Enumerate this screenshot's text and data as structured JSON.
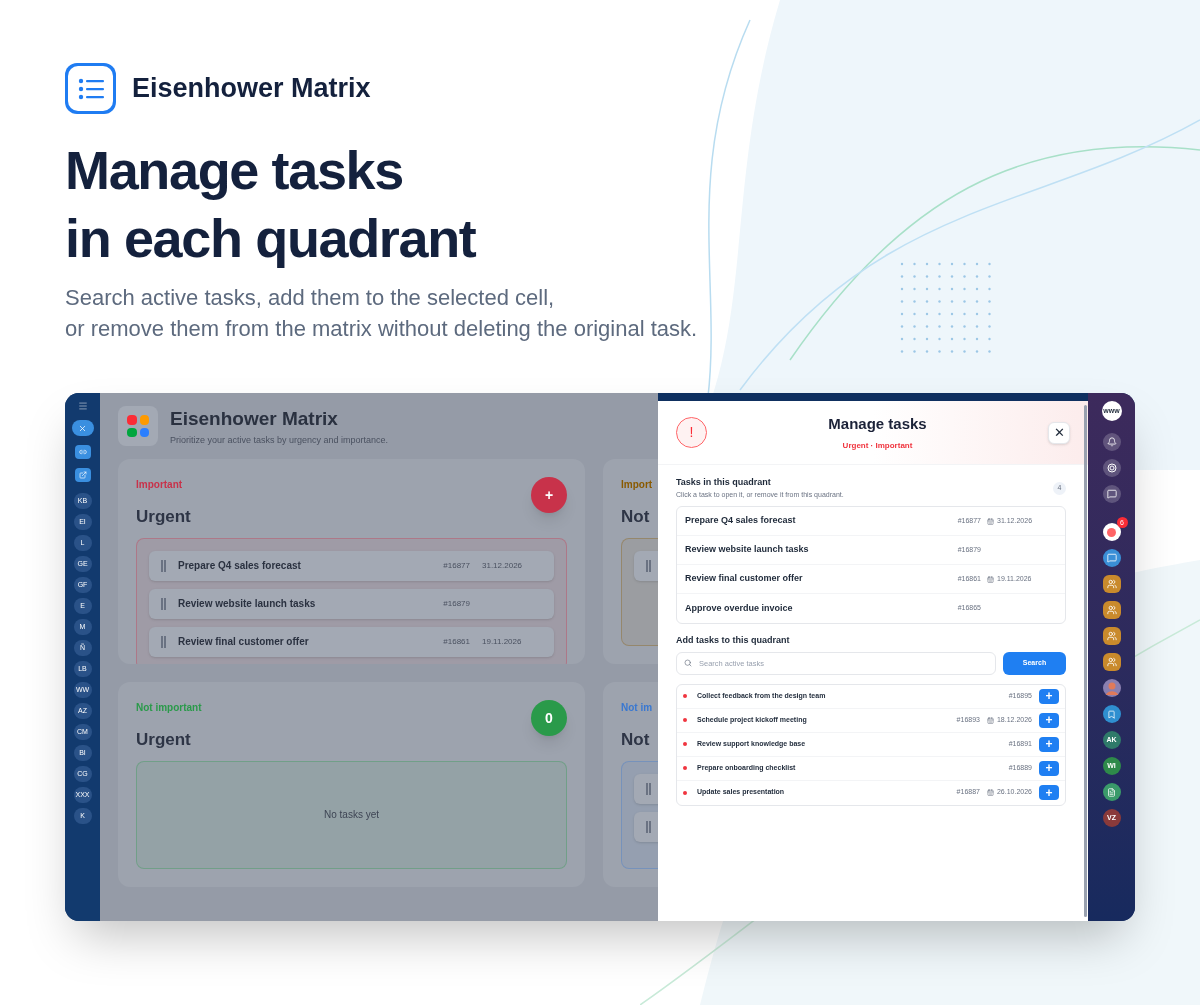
{
  "brand": {
    "title": "Eisenhower Matrix"
  },
  "hero": {
    "heading_lines": [
      "Manage tasks",
      "in each quadrant"
    ],
    "subtitle_lines": [
      "Search active tasks, add them to the selected cell,",
      "or remove them from the matrix without deleting the original task."
    ]
  },
  "sidebar": {
    "items": [
      {
        "initials": "KB"
      },
      {
        "initials": "EI"
      },
      {
        "initials": "L"
      },
      {
        "initials": "GE"
      },
      {
        "initials": "GF"
      },
      {
        "initials": "E"
      },
      {
        "initials": "M"
      },
      {
        "initials": "Ñ"
      },
      {
        "initials": "LB"
      },
      {
        "initials": "WW"
      },
      {
        "initials": "AZ"
      },
      {
        "initials": "CM"
      },
      {
        "initials": "BI"
      },
      {
        "initials": "CG"
      },
      {
        "initials": "XXX"
      },
      {
        "initials": "K"
      }
    ]
  },
  "page": {
    "title": "Eisenhower Matrix",
    "subtitle": "Prioritize your active tasks by urgency and importance."
  },
  "quadrants": [
    {
      "tag": "Important",
      "title": "Urgent",
      "color": "#c8324a",
      "badge": "+",
      "tasks": [
        {
          "kind": "task",
          "title": "Prepare Q4 sales forecast",
          "id": "#16877",
          "date": "31.12.2026"
        },
        {
          "kind": "task",
          "title": "Review website launch tasks",
          "id": "#16879"
        },
        {
          "kind": "task",
          "title": "Review final customer offer",
          "id": "#16861",
          "date": "19.11.2026"
        }
      ]
    },
    {
      "tag": "Import",
      "title": "Not",
      "color": "#8a5a00",
      "tasks": [
        {
          "kind": "cut"
        }
      ]
    },
    {
      "tag": "Not important",
      "title": "Urgent",
      "color": "#2a9a4a",
      "badge": "0",
      "empty_text": "No tasks yet"
    },
    {
      "tag": "Not im",
      "title": "Not",
      "color": "#3a78d0",
      "tasks": [
        {
          "kind": "cut"
        },
        {
          "kind": "cut"
        }
      ]
    }
  ],
  "modal": {
    "title": "Manage tasks",
    "subtitle": "Urgent · Important",
    "icon_text": "!",
    "close": "✕",
    "current": {
      "title": "Tasks in this quadrant",
      "hint": "Click a task to open it, or remove it from this quadrant.",
      "count": "4",
      "tasks": [
        {
          "title": "Prepare Q4 sales forecast",
          "id": "#16877",
          "date": "31.12.2026"
        },
        {
          "title": "Review website launch tasks",
          "id": "#16879"
        },
        {
          "title": "Review final customer offer",
          "id": "#16861",
          "date": "19.11.2026"
        },
        {
          "title": "Approve overdue invoice",
          "id": "#16865"
        }
      ]
    },
    "add": {
      "title": "Add tasks to this quadrant",
      "placeholder": "Search active tasks",
      "button": "Search",
      "add_label": "+",
      "results": [
        {
          "title": "Collect feedback from the design team",
          "id": "#16895",
          "color": "#f0353f"
        },
        {
          "title": "Schedule project kickoff meeting",
          "id": "#16893",
          "date": "18.12.2026",
          "color": "#f0353f"
        },
        {
          "title": "Review support knowledge base",
          "id": "#16891",
          "color": "#f0353f"
        },
        {
          "title": "Prepare onboarding checklist",
          "id": "#16889",
          "color": "#f0353f"
        },
        {
          "title": "Update sales presentation",
          "id": "#16887",
          "date": "26.10.2026",
          "color": "#f0353f"
        }
      ]
    }
  },
  "rail": [
    {
      "kind": "logo",
      "text": "www"
    },
    {
      "kind": "bell"
    },
    {
      "kind": "ai"
    },
    {
      "kind": "chat"
    },
    {
      "kind": "alert",
      "badge": "6"
    },
    {
      "kind": "message",
      "color": "#3a8fd6"
    },
    {
      "kind": "group",
      "color": "#c98a2c"
    },
    {
      "kind": "group",
      "color": "#c98a2c"
    },
    {
      "kind": "group",
      "color": "#c98a2c"
    },
    {
      "kind": "group",
      "color": "#c98a2c"
    },
    {
      "kind": "avatar",
      "color": "#8a7fb0"
    },
    {
      "kind": "bookmark",
      "color": "#2f8fd0"
    },
    {
      "kind": "initials",
      "text": "AK",
      "color": "#2f7a6a"
    },
    {
      "kind": "initials",
      "text": "WI",
      "color": "#2e8a4a"
    },
    {
      "kind": "doc",
      "color": "#3a9a6a"
    },
    {
      "kind": "initials",
      "text": "VZ",
      "color": "#8a3a3a"
    }
  ]
}
